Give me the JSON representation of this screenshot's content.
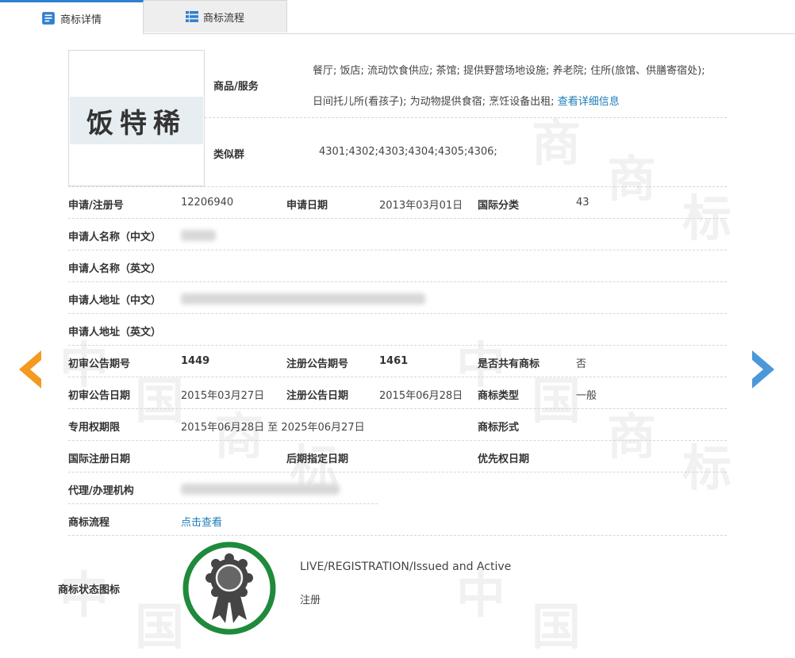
{
  "tabs": [
    {
      "label": "商标详情",
      "active": true
    },
    {
      "label": "商标流程",
      "active": false
    }
  ],
  "watermark": [
    "中",
    "国",
    "商",
    "标"
  ],
  "trademark": {
    "image_text": "饭特稀",
    "goods_services_label": "商品/服务",
    "goods_services_line1": "餐厅; 饭店; 流动饮食供应; 茶馆; 提供野营场地设施; 养老院; 住所(旅馆、供膳寄宿处);",
    "goods_services_line2": "日间托儿所(看孩子); 为动物提供食宿; 烹饪设备出租;",
    "view_details_link": "查看详细信息",
    "similar_group_label": "类似群",
    "similar_group_value": "4301;4302;4303;4304;4305;4306;"
  },
  "fields": {
    "reg_no_label": "申请/注册号",
    "reg_no": "12206940",
    "apply_date_label": "申请日期",
    "apply_date": "2013年03月01日",
    "intl_class_label": "国际分类",
    "intl_class": "43",
    "applicant_cn_label": "申请人名称（中文）",
    "applicant_en_label": "申请人名称（英文）",
    "address_cn_label": "申请人地址（中文）",
    "address_en_label": "申请人地址（英文）",
    "prelim_issue_label": "初审公告期号",
    "prelim_issue": "1449",
    "reg_issue_label": "注册公告期号",
    "reg_issue": "1461",
    "shared_label": "是否共有商标",
    "shared": "否",
    "prelim_date_label": "初审公告日期",
    "prelim_date": "2015年03月27日",
    "reg_date_label": "注册公告日期",
    "reg_date": "2015年06月28日",
    "tm_type_label": "商标类型",
    "tm_type": "一般",
    "exclusive_label": "专用权期限",
    "exclusive_period": "2015年06月28日 至 2025年06月27日",
    "tm_form_label": "商标形式",
    "intl_reg_date_label": "国际注册日期",
    "later_designation_label": "后期指定日期",
    "priority_date_label": "优先权日期",
    "agent_label": "代理/办理机构",
    "process_label": "商标流程",
    "process_link": "点击查看",
    "status_icon_label": "商标状态图标",
    "status_en": "LIVE/REGISTRATION/Issued and Active",
    "status_cn": "注册"
  },
  "colors": {
    "accent": "#2f7fd1",
    "link": "#1d7db8",
    "arrow_left": "#f39a1f",
    "arrow_right": "#4a98d8",
    "status_ring": "#1f8a3c"
  }
}
